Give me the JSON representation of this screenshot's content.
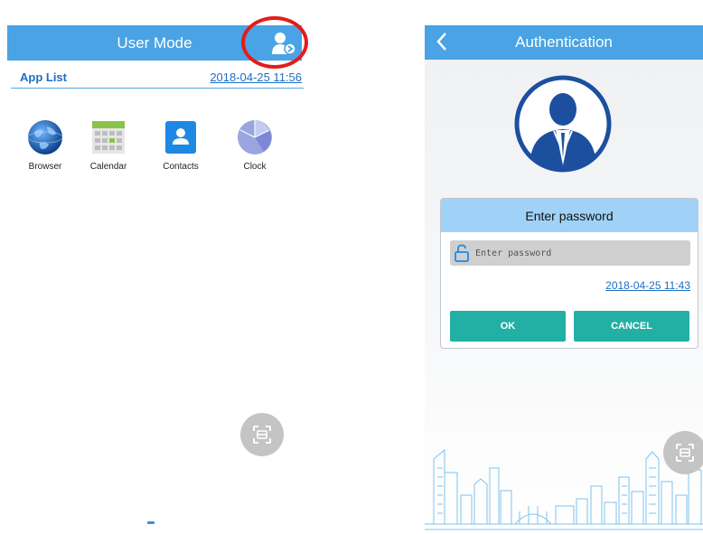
{
  "left_screen": {
    "title": "User Mode",
    "app_list_label": "App List",
    "app_list_date": "2018-04-25 11:56",
    "apps": [
      {
        "label": "Browser",
        "icon": "globe-icon"
      },
      {
        "label": "Calendar",
        "icon": "calendar-icon"
      },
      {
        "label": "Contacts",
        "icon": "contacts-icon"
      },
      {
        "label": "Clock",
        "icon": "clock-icon"
      }
    ],
    "annotation": "red-highlight-circle"
  },
  "right_screen": {
    "title": "Authentication",
    "dialog": {
      "title": "Enter password",
      "password_placeholder": "Enter password",
      "date": "2018-04-25 11:43",
      "ok_label": "OK",
      "cancel_label": "CANCEL"
    }
  },
  "colors": {
    "title_bar": "#4aa3e4",
    "dialog_header": "#9fd2f6",
    "button": "#22b0a5",
    "link": "#1f6fc0",
    "highlight": "#e31c1c"
  }
}
